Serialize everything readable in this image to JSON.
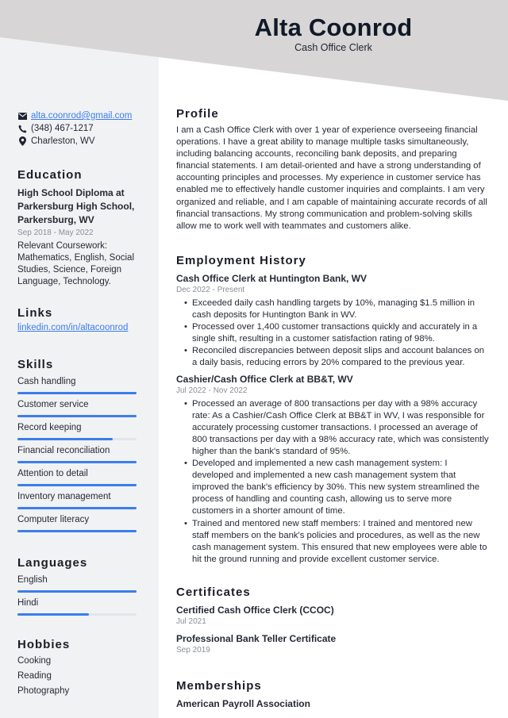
{
  "header": {
    "name": "Alta Coonrod",
    "title": "Cash Office Clerk"
  },
  "colors": {
    "accent": "#3b7ded",
    "header_bg": "#d7d5d5",
    "sidebar_bg": "#f1f2f4",
    "muted_text": "#8a8f98"
  },
  "contact": {
    "email": "alta.coonrod@gmail.com",
    "phone": "(348) 467-1217",
    "location": "Charleston, WV",
    "icons": [
      "envelope-icon",
      "phone-icon",
      "map-pin-icon"
    ]
  },
  "education": {
    "heading": "Education",
    "degree": "High School Diploma at Parkersburg High School, Parkersburg, WV",
    "dates": "Sep 2018 - May 2022",
    "details": "Relevant Coursework: Mathematics, English, Social Studies, Science, Foreign Language, Technology."
  },
  "links": {
    "heading": "Links",
    "items": [
      "linkedin.com/in/altacoonrod"
    ]
  },
  "skills": {
    "heading": "Skills",
    "items": [
      {
        "label": "Cash handling",
        "level": 1.0
      },
      {
        "label": "Customer service",
        "level": 1.0
      },
      {
        "label": "Record keeping",
        "level": 0.8
      },
      {
        "label": "Financial reconciliation",
        "level": 1.0
      },
      {
        "label": "Attention to detail",
        "level": 1.0
      },
      {
        "label": "Inventory management",
        "level": 1.0
      },
      {
        "label": "Computer literacy",
        "level": 1.0
      }
    ]
  },
  "languages": {
    "heading": "Languages",
    "items": [
      {
        "label": "English",
        "level": 1.0
      },
      {
        "label": "Hindi",
        "level": 0.6
      }
    ]
  },
  "hobbies": {
    "heading": "Hobbies",
    "items": [
      "Cooking",
      "Reading",
      "Photography"
    ]
  },
  "profile": {
    "heading": "Profile",
    "text": "I am a Cash Office Clerk with over 1 year of experience overseeing financial operations. I have a great ability to manage multiple tasks simultaneously, including balancing accounts, reconciling bank deposits, and preparing financial statements. I am detail-oriented and have a strong understanding of accounting principles and processes. My experience in customer service has enabled me to effectively handle customer inquiries and complaints. I am very organized and reliable, and I am capable of maintaining accurate records of all financial transactions. My strong communication and problem-solving skills allow me to work well with teammates and customers alike."
  },
  "employment": {
    "heading": "Employment History",
    "jobs": [
      {
        "title": "Cash Office Clerk at Huntington Bank, WV",
        "dates": "Dec 2022 - Present",
        "bullets": [
          "Exceeded daily cash handling targets by 10%, managing $1.5 million in cash deposits for Huntington Bank in WV.",
          "Processed over 1,400 customer transactions quickly and accurately in a single shift, resulting in a customer satisfaction rating of 98%.",
          "Reconciled discrepancies between deposit slips and account balances on a daily basis, reducing errors by 20% compared to the previous year."
        ]
      },
      {
        "title": "Cashier/Cash Office Clerk at BB&T, WV",
        "dates": "Jul 2022 - Nov 2022",
        "bullets": [
          "Processed an average of 800 transactions per day with a 98% accuracy rate: As a Cashier/Cash Office Clerk at BB&T in WV, I was responsible for accurately processing customer transactions. I processed an average of 800 transactions per day with a 98% accuracy rate, which was consistently higher than the bank's standard of 95%.",
          "Developed and implemented a new cash management system: I developed and implemented a new cash management system that improved the bank's efficiency by 30%. This new system streamlined the process of handling and counting cash, allowing us to serve more customers in a shorter amount of time.",
          "Trained and mentored new staff members: I trained and mentored new staff members on the bank's policies and procedures, as well as the new cash management system. This ensured that new employees were able to hit the ground running and provide excellent customer service."
        ]
      }
    ]
  },
  "certificates": {
    "heading": "Certificates",
    "items": [
      {
        "title": "Certified Cash Office Clerk (CCOC)",
        "date": "Jul 2021"
      },
      {
        "title": "Professional Bank Teller Certificate",
        "date": "Sep 2019"
      }
    ]
  },
  "memberships": {
    "heading": "Memberships",
    "items": [
      "American Payroll Association"
    ]
  }
}
